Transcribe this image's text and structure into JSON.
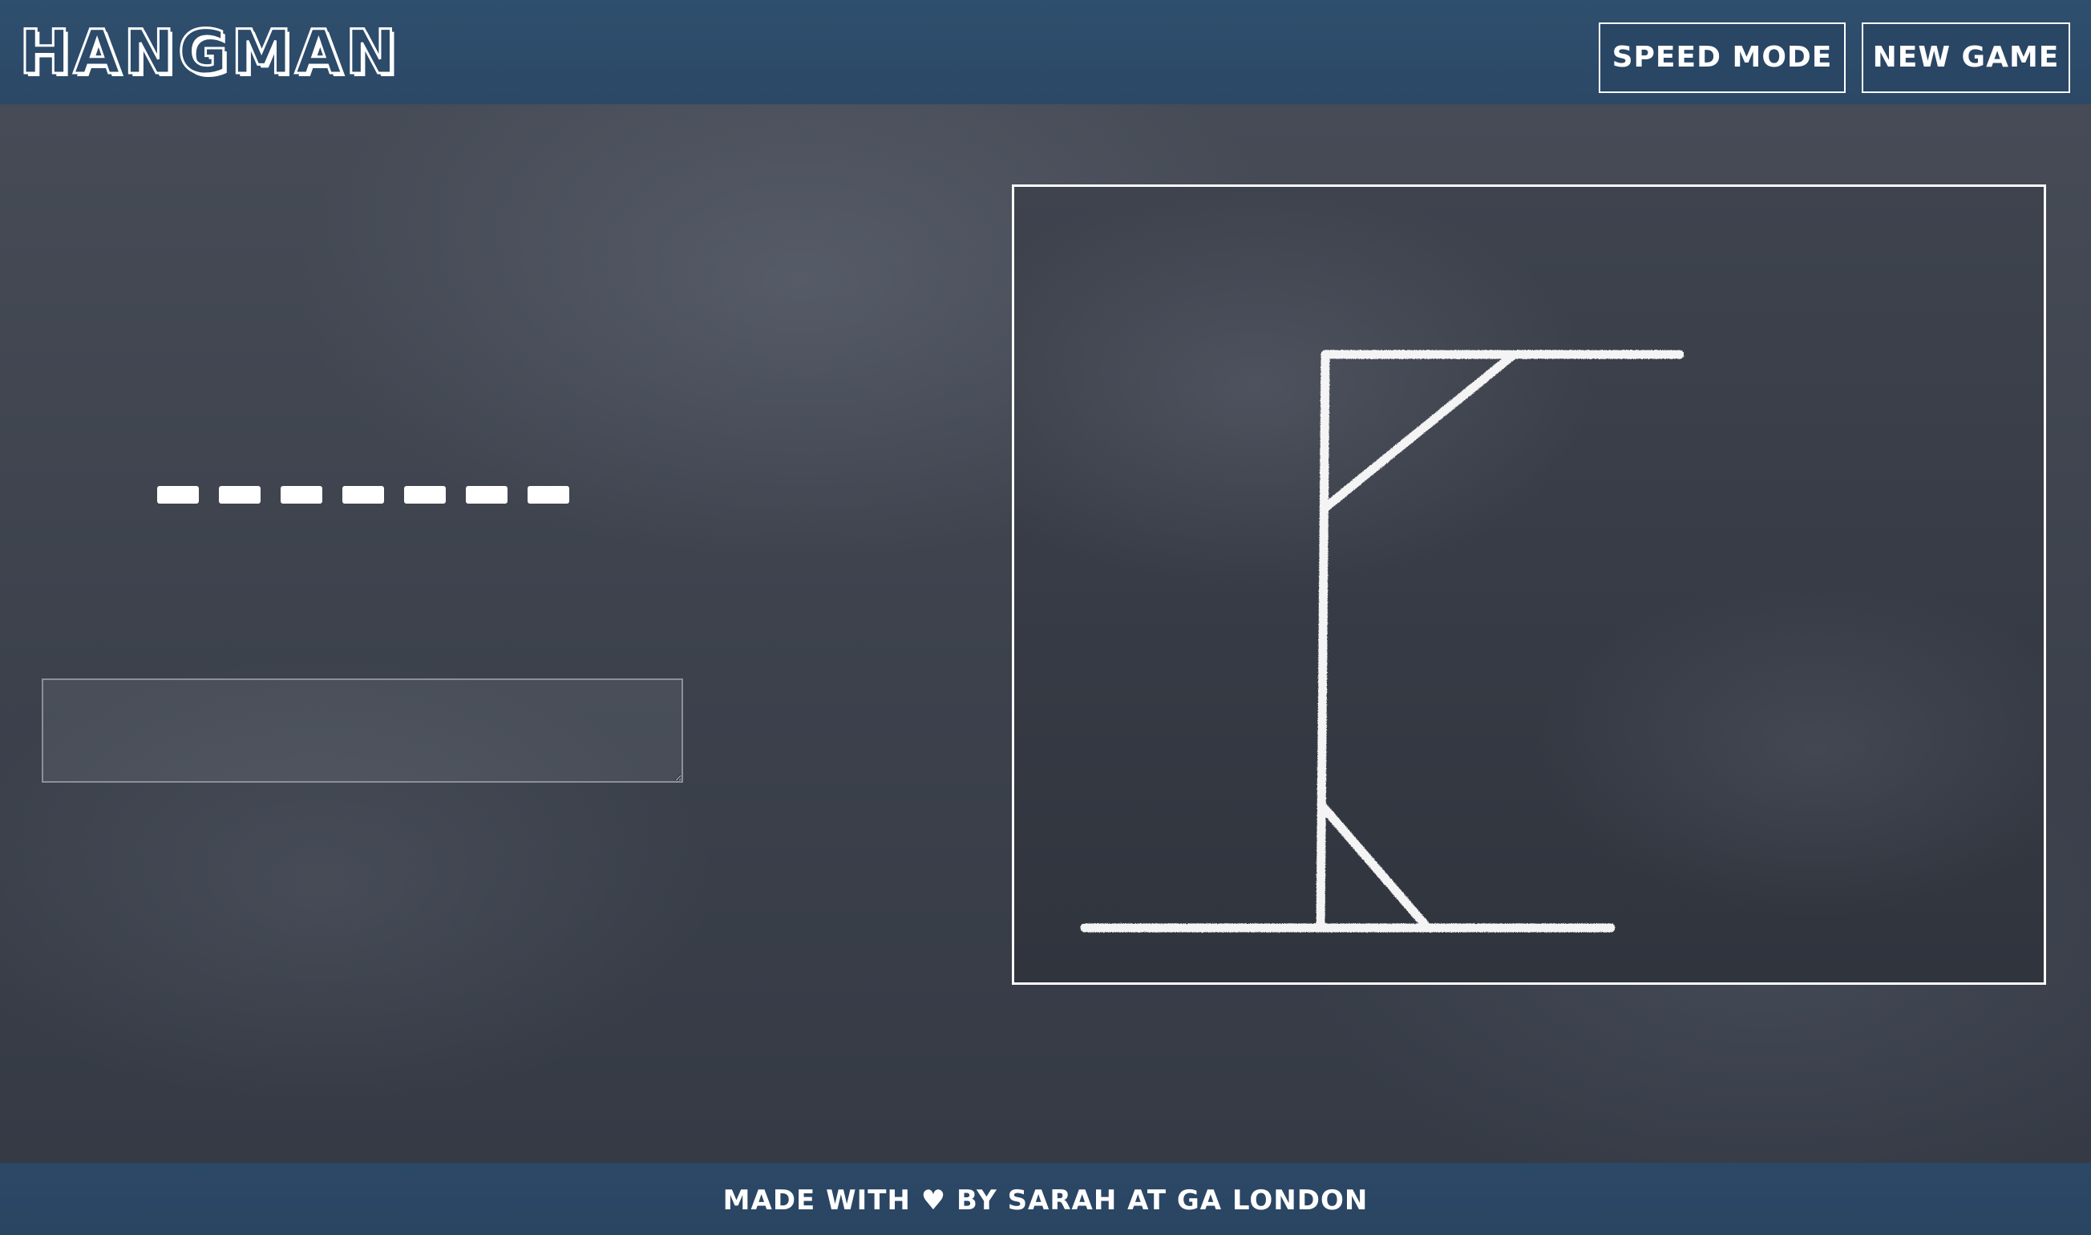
{
  "header": {
    "title": "Hangman",
    "buttons": {
      "speed_mode": "Speed Mode",
      "new_game": "New Game"
    }
  },
  "game": {
    "word_length": 7,
    "guess_input": {
      "value": "",
      "placeholder": ""
    },
    "gallows_parts_drawn": [
      "base",
      "pole",
      "beam",
      "top-brace",
      "bottom-brace"
    ]
  },
  "footer": {
    "text": "Made with ♥ by Sarah at GA London"
  },
  "colors": {
    "bar": "#2c4a69",
    "board": "#3f4450",
    "chalk": "#ffffff"
  }
}
